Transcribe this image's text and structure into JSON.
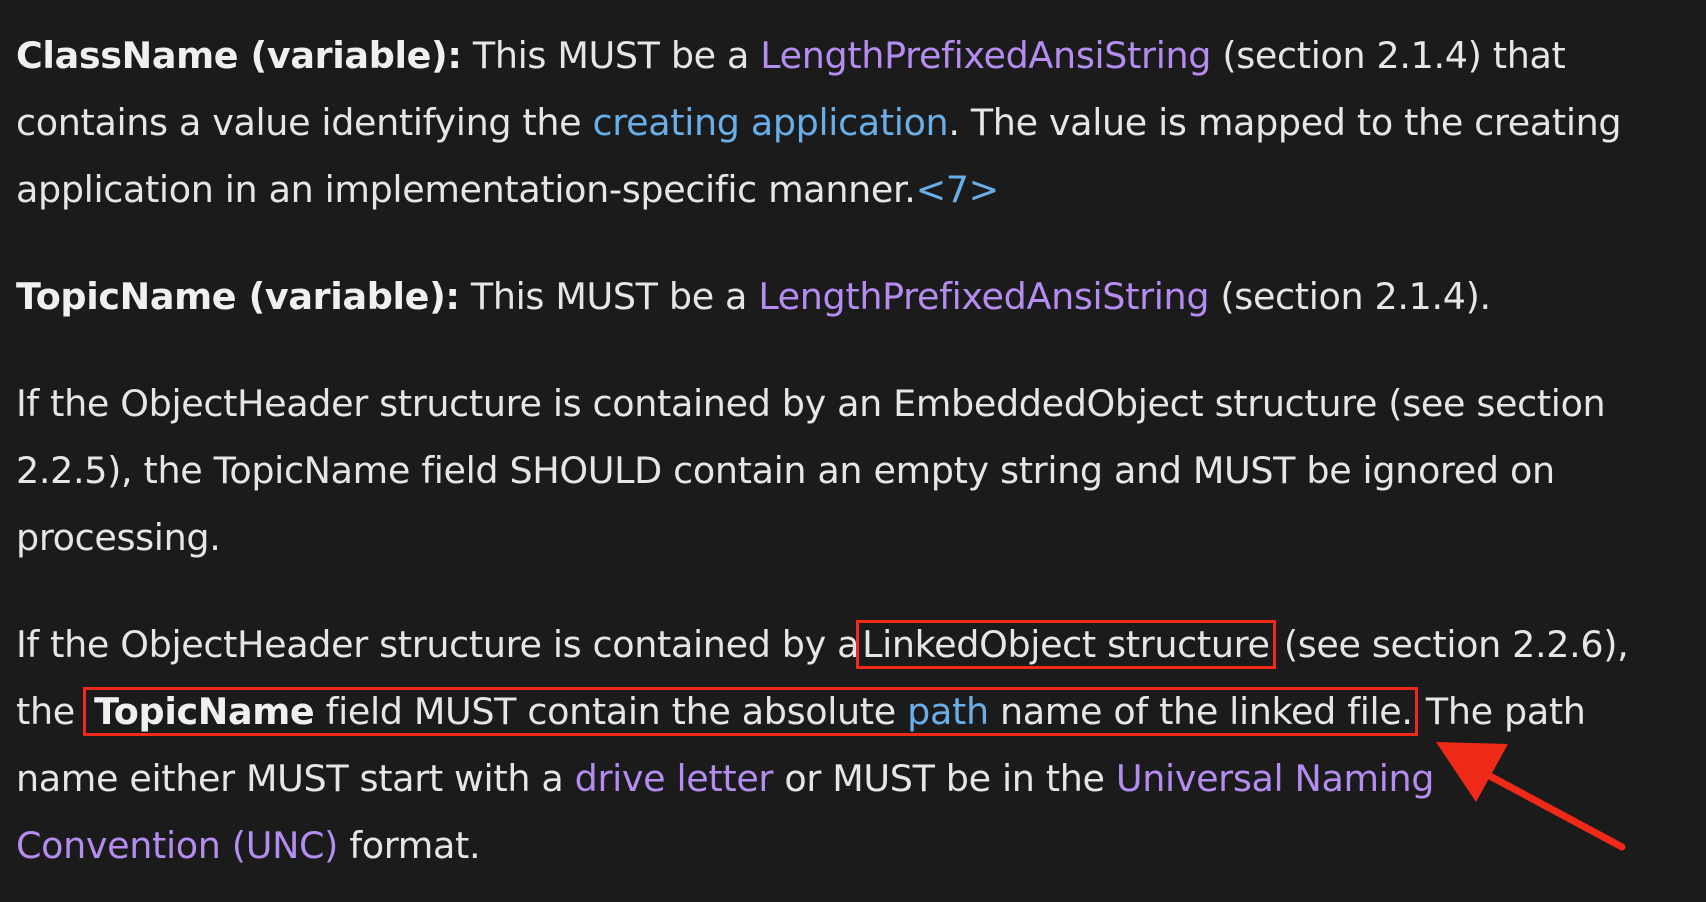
{
  "doc": {
    "p1": {
      "term": "ClassName (variable):",
      "t1": " This MUST be a ",
      "link1": "LengthPrefixedAnsiString",
      "t2": " (section 2.1.4) that",
      "t3": "contains a value identifying the ",
      "link2": "creating application",
      "t4": ". The value is mapped to the creating",
      "t5": "application in an implementation-specific manner.",
      "note": "<7>"
    },
    "p2": {
      "term": "TopicName (variable):",
      "t1": " This MUST be a ",
      "link1": "LengthPrefixedAnsiString",
      "t2": " (section 2.1.4)."
    },
    "p3": {
      "l1": "If the ObjectHeader structure is contained by an EmbeddedObject structure (see section",
      "l2": "2.2.5), the TopicName field SHOULD contain an empty string and MUST be ignored on",
      "l3": "processing."
    },
    "p4": {
      "t1": "If the ObjectHeader structure is contained by a",
      "hl1": "LinkedObject structure",
      "t2": " (see section 2.2.6),",
      "t3": "the ",
      "bold": "TopicName",
      "t4": " field MUST contain the absolute ",
      "link_path": "path",
      "t5": " name of the linked file.",
      "t6": " The path",
      "t7": "name either MUST start with a ",
      "link_drive": "drive letter",
      "t8": " or MUST be in the ",
      "link_unc1": "Universal Naming",
      "link_unc2": "Convention (UNC)",
      "t9": " format."
    }
  },
  "colors": {
    "background": "#1b1b1b",
    "text": "#e6e6e6",
    "link_purple": "#b58cf0",
    "link_blue": "#6aaee8",
    "annotation_red": "#f02a18"
  },
  "annotation": {
    "arrow_icon": "red-arrow-icon"
  }
}
